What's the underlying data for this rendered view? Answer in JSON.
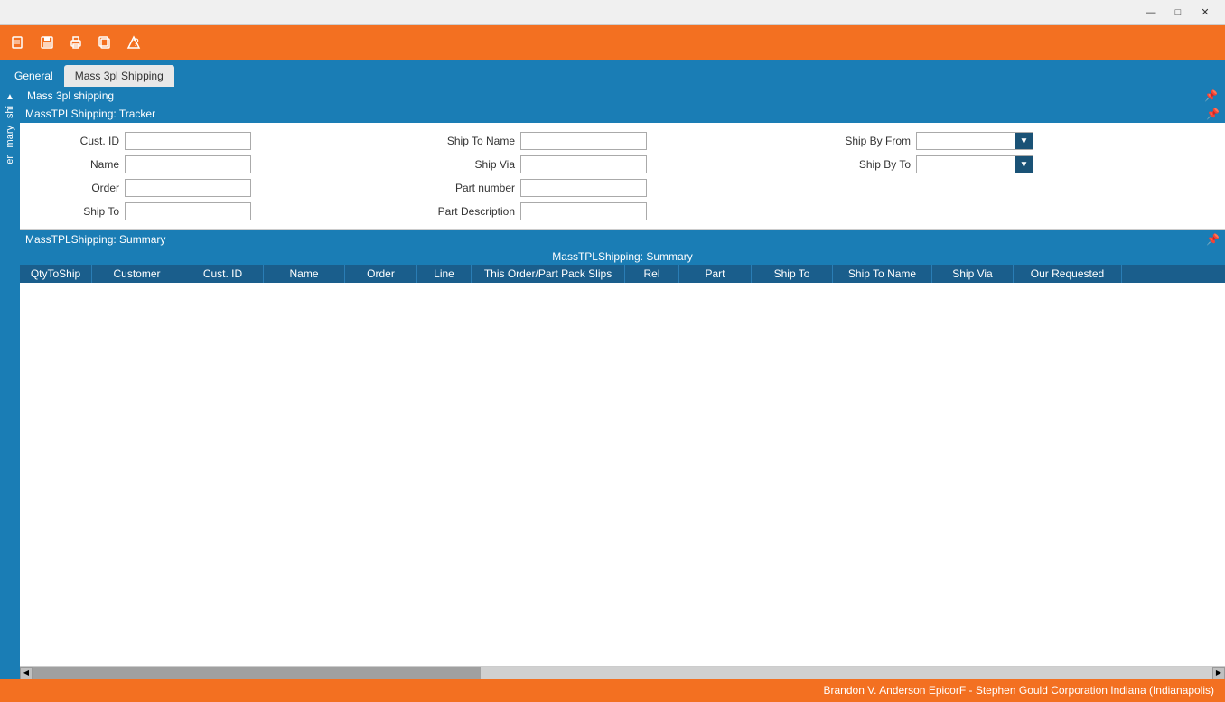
{
  "titlebar": {
    "minimize_label": "—",
    "maximize_label": "□",
    "close_label": "✕"
  },
  "toolbar": {
    "buttons": [
      {
        "name": "new-icon",
        "symbol": "🖊"
      },
      {
        "name": "save-icon",
        "symbol": "💾"
      },
      {
        "name": "print-icon",
        "symbol": "🖨"
      },
      {
        "name": "copy-icon",
        "symbol": "📋"
      },
      {
        "name": "help-icon",
        "symbol": "?"
      }
    ]
  },
  "tabs": [
    {
      "label": "General",
      "active": false
    },
    {
      "label": "Mass 3pl Shipping",
      "active": true
    }
  ],
  "sidebar": {
    "items": [
      {
        "label": "shi"
      },
      {
        "label": "mary"
      },
      {
        "label": "er"
      }
    ]
  },
  "mass3pl_header": {
    "title": "Mass 3pl shipping",
    "pin": "📌"
  },
  "tracker": {
    "header": "MassTPLShipping: Tracker",
    "pin": "📌",
    "fields": {
      "cust_id_label": "Cust. ID",
      "name_label": "Name",
      "order_label": "Order",
      "ship_to_label": "Ship To",
      "ship_to_name_label": "Ship To Name",
      "ship_via_label": "Ship Via",
      "part_number_label": "Part number",
      "part_description_label": "Part Description",
      "ship_by_from_label": "Ship By From",
      "ship_by_to_label": "Ship By To"
    }
  },
  "summary": {
    "section_header": "MassTPLShipping: Summary",
    "table_title": "MassTPLShipping: Summary",
    "pin": "📌",
    "columns": [
      {
        "label": "QtyToShip",
        "key": "qty"
      },
      {
        "label": "Customer",
        "key": "customer"
      },
      {
        "label": "Cust. ID",
        "key": "custid"
      },
      {
        "label": "Name",
        "key": "name"
      },
      {
        "label": "Order",
        "key": "order"
      },
      {
        "label": "Line",
        "key": "line"
      },
      {
        "label": "This Order/Part Pack Slips",
        "key": "packslips"
      },
      {
        "label": "Rel",
        "key": "rel"
      },
      {
        "label": "Part",
        "key": "part"
      },
      {
        "label": "Ship To",
        "key": "shipto"
      },
      {
        "label": "Ship To Name",
        "key": "shiptoname"
      },
      {
        "label": "Ship Via",
        "key": "shipvia"
      },
      {
        "label": "Our Requested",
        "key": "ourreq"
      }
    ],
    "rows": []
  },
  "statusbar": {
    "text": "Brandon V. Anderson  EpicorF - Stephen Gould Corporation  Indiana (Indianapolis)"
  }
}
